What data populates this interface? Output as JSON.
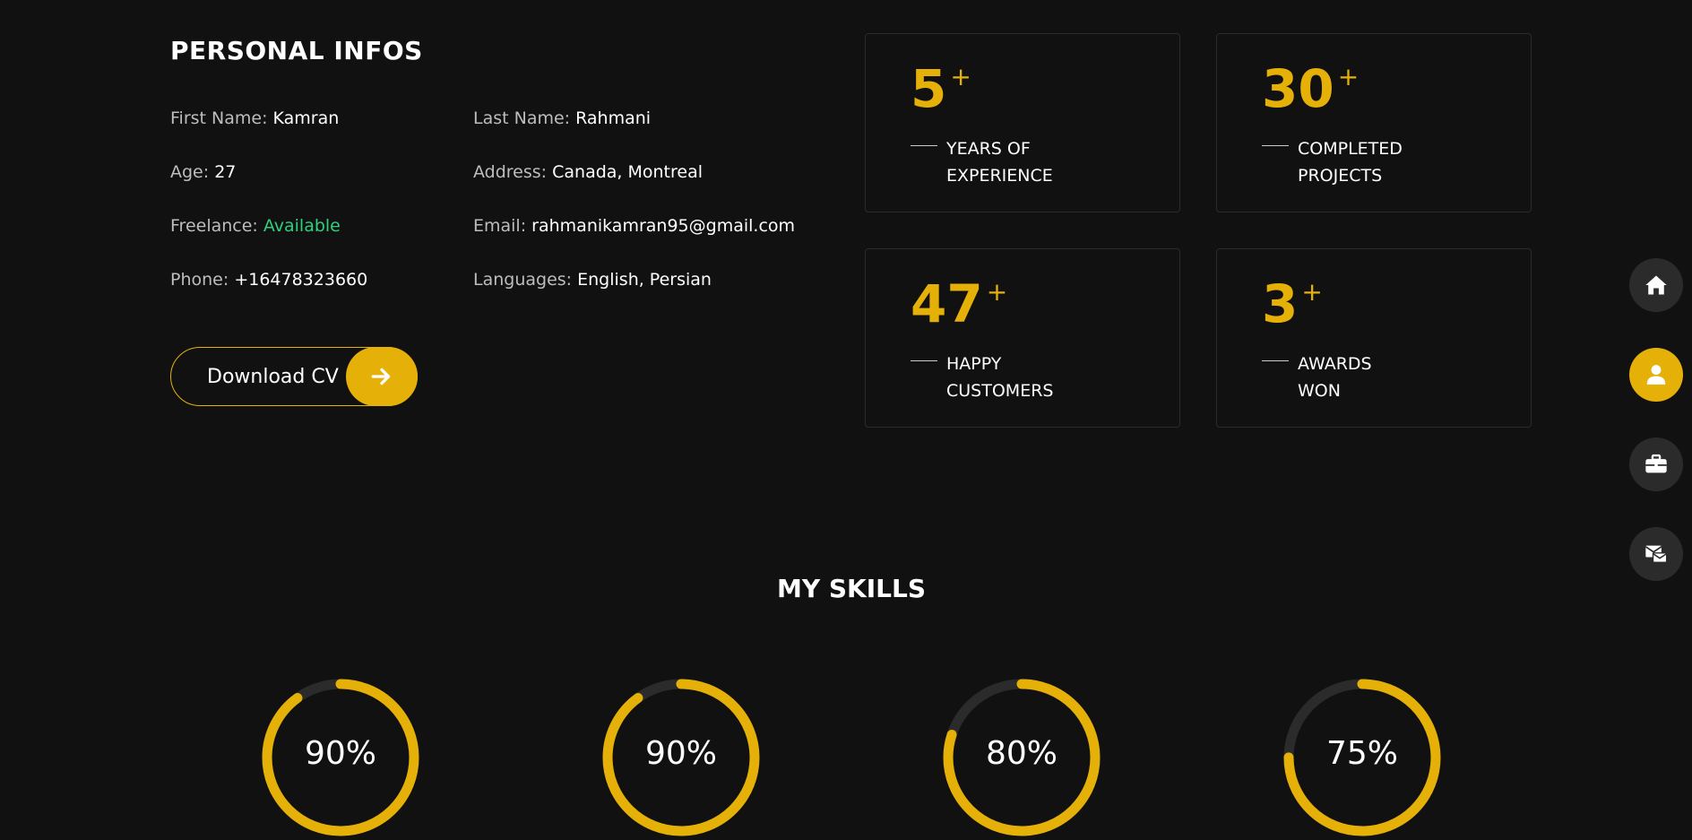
{
  "personal": {
    "title": "PERSONAL INFOS",
    "fields": {
      "first_name": {
        "label": "First Name:",
        "value": "Kamran"
      },
      "last_name": {
        "label": "Last Name:",
        "value": "Rahmani"
      },
      "age": {
        "label": "Age:",
        "value": "27"
      },
      "address": {
        "label": "Address:",
        "value": "Canada, Montreal"
      },
      "freelance": {
        "label": "Freelance:",
        "value": "Available"
      },
      "email": {
        "label": "Email:",
        "value": "rahmanikamran95@gmail.com"
      },
      "phone": {
        "label": "Phone:",
        "value": "+16478323660"
      },
      "languages": {
        "label": "Languages:",
        "value": "English, Persian"
      }
    },
    "download_cv_label": "Download CV"
  },
  "stats": [
    {
      "number": "5",
      "suffix": "+",
      "line1": "YEARS OF",
      "line2": "EXPERIENCE"
    },
    {
      "number": "30",
      "suffix": "+",
      "line1": "COMPLETED",
      "line2": "PROJECTS"
    },
    {
      "number": "47",
      "suffix": "+",
      "line1": "HAPPY",
      "line2": "CUSTOMERS"
    },
    {
      "number": "3",
      "suffix": "+",
      "line1": "AWARDS",
      "line2": "WON"
    }
  ],
  "skills": {
    "title": "MY SKILLS",
    "items": [
      {
        "value_label": "90%",
        "percent": 90
      },
      {
        "value_label": "90%",
        "percent": 90
      },
      {
        "value_label": "80%",
        "percent": 80
      },
      {
        "value_label": "75%",
        "percent": 75
      }
    ]
  },
  "side_nav": {
    "items": [
      {
        "icon": "home-icon",
        "active": false
      },
      {
        "icon": "user-icon",
        "active": true
      },
      {
        "icon": "briefcase-icon",
        "active": false
      },
      {
        "icon": "mail-icon",
        "active": false
      }
    ]
  },
  "colors": {
    "background": "#111111",
    "accent": "#e5b008",
    "available": "#2fcf7e",
    "track": "#2b2b2b"
  }
}
